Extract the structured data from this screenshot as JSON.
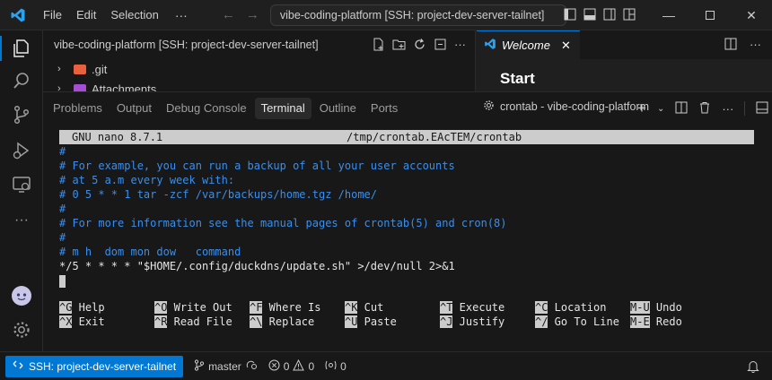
{
  "titlebar": {
    "menus": [
      "File",
      "Edit",
      "Selection"
    ],
    "more": "···",
    "command_center": "vibe-coding-platform [SSH: project-dev-server-tailnet]"
  },
  "sidebar": {
    "title": "vibe-coding-platform [SSH: project-dev-server-tailnet]",
    "items": [
      {
        "label": ".git",
        "icon": "folder-git-icon",
        "color": "#e8603c"
      },
      {
        "label": "Attachments",
        "icon": "folder-icon",
        "color": "#a64dd6"
      }
    ]
  },
  "editor": {
    "tab_label": "Welcome",
    "heading": "Start"
  },
  "panel": {
    "tabs": [
      "Problems",
      "Output",
      "Debug Console",
      "Terminal",
      "Outline",
      "Ports"
    ],
    "active_tab": "Terminal",
    "terminal_name": "crontab - vibe-coding-platform"
  },
  "terminal": {
    "nano_version": "GNU nano 8.7.1",
    "file_path": "/tmp/crontab.EAcTEM/crontab",
    "lines": [
      "#",
      "# For example, you can run a backup of all your user accounts",
      "# at 5 a.m every week with:",
      "# 0 5 * * 1 tar -zcf /var/backups/home.tgz /home/",
      "#",
      "# For more information see the manual pages of crontab(5) and cron(8)",
      "#",
      "# m h  dom mon dow   command"
    ],
    "cron_entry": "*/5 * * * * \"$HOME/.config/duckdns/update.sh\" >/dev/null 2>&1",
    "shortcuts_row1": [
      {
        "key": "^G",
        "label": "Help"
      },
      {
        "key": "^O",
        "label": "Write Out"
      },
      {
        "key": "^F",
        "label": "Where Is"
      },
      {
        "key": "^K",
        "label": "Cut"
      },
      {
        "key": "^T",
        "label": "Execute"
      },
      {
        "key": "^C",
        "label": "Location"
      },
      {
        "key": "M-U",
        "label": "Undo"
      }
    ],
    "shortcuts_row2": [
      {
        "key": "^X",
        "label": "Exit"
      },
      {
        "key": "^R",
        "label": "Read File"
      },
      {
        "key": "^\\",
        "label": "Replace"
      },
      {
        "key": "^U",
        "label": "Paste"
      },
      {
        "key": "^J",
        "label": "Justify"
      },
      {
        "key": "^/",
        "label": "Go To Line"
      },
      {
        "key": "M-E",
        "label": "Redo"
      }
    ]
  },
  "statusbar": {
    "remote": "SSH: project-dev-server-tailnet",
    "branch": "master",
    "errors": "0",
    "warnings": "0",
    "ports": "0"
  },
  "colors": {
    "accent": "#0078d4",
    "comment": "#3b8eea"
  }
}
